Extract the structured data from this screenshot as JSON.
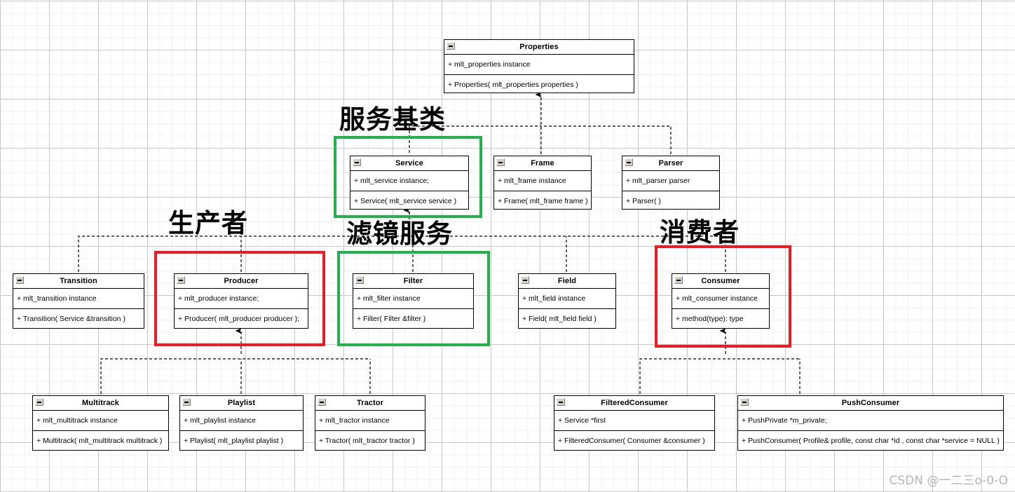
{
  "diagram": {
    "title": "MLT C++ class hierarchy UML diagram",
    "watermark": "CSDN @一二三o-0-O",
    "colors": {
      "highlight_red": "#ed1c24",
      "highlight_green": "#22b14c",
      "box_border": "#000000",
      "grid_major": "#c9c9c9",
      "grid_minor": "#f0f0f0"
    }
  },
  "annotations": [
    {
      "id": "service-base",
      "text": "服务基类"
    },
    {
      "id": "producer",
      "text": "生产者"
    },
    {
      "id": "filter-service",
      "text": "滤镜服务"
    },
    {
      "id": "consumer",
      "text": "消费者"
    }
  ],
  "classes": {
    "properties": {
      "name": "Properties",
      "attribute": "+ mlt_properties instance",
      "method": "+ Properties( mlt_properties properties )"
    },
    "service": {
      "name": "Service",
      "attribute": "+ mlt_service instance;",
      "method": "+ Service( mlt_service service )"
    },
    "frame": {
      "name": "Frame",
      "attribute": "+ mlt_frame instance",
      "method": "+ Frame( mlt_frame frame )"
    },
    "parser": {
      "name": "Parser",
      "attribute": "+ mlt_parser parser",
      "method": "+ Parser( )"
    },
    "transition": {
      "name": "Transition",
      "attribute": "+ mlt_transition instance",
      "method": "+ Transition( Service &transition )"
    },
    "producer": {
      "name": "Producer",
      "attribute": "+ mlt_producer instance;",
      "method": "+ Producer( mlt_producer producer );"
    },
    "filter": {
      "name": "Filter",
      "attribute": "+ mlt_filter instance",
      "method": "+ Filter( Filter &filter )"
    },
    "field": {
      "name": "Field",
      "attribute": "+ mlt_field instance",
      "method": "+ Field( mlt_field field )"
    },
    "consumer": {
      "name": "Consumer",
      "attribute": "+ mlt_consumer instance",
      "method": "+ method(type): type"
    },
    "multitrack": {
      "name": "Multitrack",
      "attribute": "+ mlt_multitrack instance",
      "method": "+ Multitrack( mlt_multitrack multitrack )"
    },
    "playlist": {
      "name": "Playlist",
      "attribute": "+ mlt_playlist instance",
      "method": "+ Playlist( mlt_playlist playlist )"
    },
    "tractor": {
      "name": "Tractor",
      "attribute": "+ mlt_tractor instance",
      "method": "+ Tractor( mlt_tractor tractor )"
    },
    "filtered_consumer": {
      "name": "FilteredConsumer",
      "attribute": "+ Service *first",
      "method": "+ FilteredConsumer( Consumer &consumer )"
    },
    "push_consumer": {
      "name": "PushConsumer",
      "attribute": "+ PushPrivate *m_private;",
      "method": "+ PushConsumer( Profile& profile, const char *id , const char *service = NULL )"
    }
  }
}
